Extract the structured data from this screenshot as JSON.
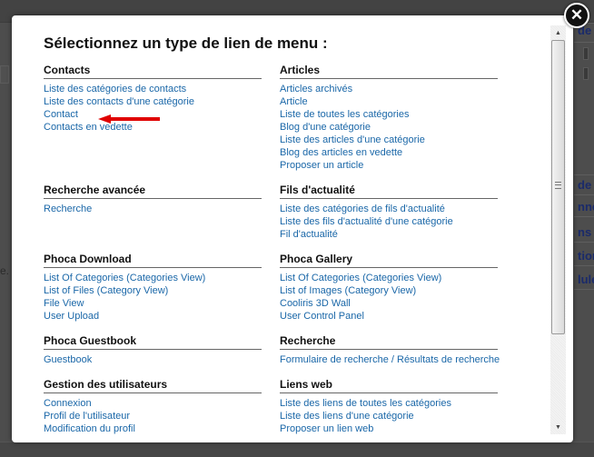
{
  "background": {
    "left_fragment": "e.",
    "right_fragments": [
      "de",
      "de",
      "nné",
      "ns",
      "tion",
      "lule"
    ]
  },
  "modal": {
    "title": "Sélectionnez un type de lien de menu :",
    "close_icon": "close-icon",
    "columns": [
      [
        {
          "heading": "Contacts",
          "items": [
            "Liste des catégories de contacts",
            "Liste des contacts d'une catégorie",
            "Contact",
            "Contacts en vedette"
          ]
        },
        {
          "heading": "Recherche avancée",
          "items": [
            "Recherche"
          ]
        },
        {
          "heading": "Phoca Download",
          "items": [
            "List Of Categories (Categories View)",
            "List of Files (Category View)",
            "File View",
            "User Upload"
          ]
        },
        {
          "heading": "Phoca Guestbook",
          "items": [
            "Guestbook"
          ]
        },
        {
          "heading": "Gestion des utilisateurs",
          "items": [
            "Connexion",
            "Profil de l'utilisateur",
            "Modification du profil"
          ]
        }
      ],
      [
        {
          "heading": "Articles",
          "items": [
            "Articles archivés",
            "Article",
            "Liste de toutes les catégories",
            "Blog d'une catégorie",
            "Liste des articles d'une catégorie",
            "Blog des articles en vedette",
            "Proposer un article"
          ]
        },
        {
          "heading": "Fils d'actualité",
          "items": [
            "Liste des catégories de fils d'actualité",
            "Liste des fils d'actualité d'une catégorie",
            "Fil d'actualité"
          ]
        },
        {
          "heading": "Phoca Gallery",
          "items": [
            "List Of Categories (Categories View)",
            "List of Images (Category View)",
            "Cooliris 3D Wall",
            "User Control Panel"
          ]
        },
        {
          "heading": "Recherche",
          "items": [
            "Formulaire de recherche / Résultats de recherche"
          ]
        },
        {
          "heading": "Liens web",
          "items": [
            "Liste des liens de toutes les catégories",
            "Liste des liens d'une catégorie",
            "Proposer un lien web"
          ]
        }
      ]
    ],
    "annotation": {
      "type": "arrow",
      "points_to": "Contact",
      "color": "#e00000"
    }
  },
  "scrollbar": {
    "up_icon": "▲",
    "down_icon": "▼",
    "grip_icon": "≡"
  },
  "colors": {
    "link": "#1a67a8",
    "heading": "#111111",
    "overlay": "#4d4d4d"
  }
}
